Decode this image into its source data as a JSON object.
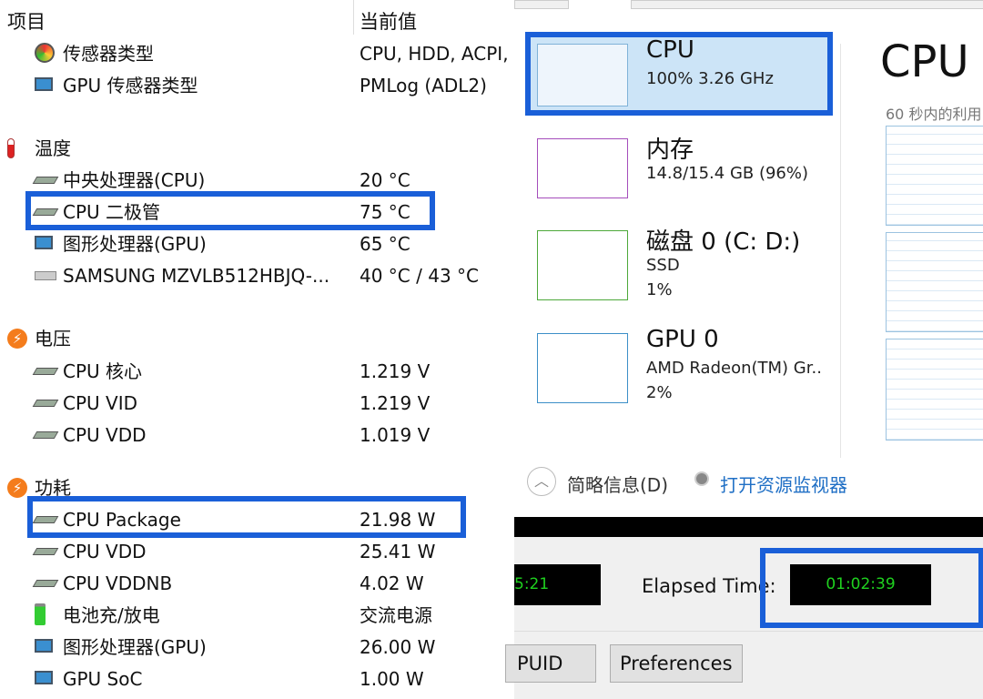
{
  "sensor_panel": {
    "header": {
      "item": "项目",
      "value": "当前值"
    },
    "rows": [
      {
        "type": "item",
        "icon": "gauge-icon",
        "label": "传感器类型",
        "value": "CPU, HDD, ACPI,"
      },
      {
        "type": "item",
        "icon": "monitor-icon",
        "label": "GPU 传感器类型",
        "value": "PMLog  (ADL2)"
      },
      {
        "type": "section",
        "icon": "thermometer-icon",
        "label": "温度"
      },
      {
        "type": "item",
        "icon": "chip-icon",
        "label": "中央处理器(CPU)",
        "value": "20 °C"
      },
      {
        "type": "item",
        "icon": "chip-icon",
        "label": "CPU 二极管",
        "value": "75 °C",
        "highlight": true
      },
      {
        "type": "item",
        "icon": "monitor-icon",
        "label": "图形处理器(GPU)",
        "value": "65 °C"
      },
      {
        "type": "item",
        "icon": "drive-icon",
        "label": "SAMSUNG MZVLB512HBJQ-...",
        "value": "40 °C / 43 °C"
      },
      {
        "type": "section",
        "icon": "lightning-icon",
        "label": "电压"
      },
      {
        "type": "item",
        "icon": "chip-icon",
        "label": "CPU 核心",
        "value": "1.219 V"
      },
      {
        "type": "item",
        "icon": "chip-icon",
        "label": "CPU VID",
        "value": "1.219 V"
      },
      {
        "type": "item",
        "icon": "chip-icon",
        "label": "CPU VDD",
        "value": "1.019 V"
      },
      {
        "type": "section",
        "icon": "lightning-icon",
        "label": "功耗"
      },
      {
        "type": "item",
        "icon": "chip-icon",
        "label": "CPU Package",
        "value": "21.98 W",
        "highlight": true
      },
      {
        "type": "item",
        "icon": "chip-icon",
        "label": "CPU VDD",
        "value": "25.41 W"
      },
      {
        "type": "item",
        "icon": "chip-icon",
        "label": "CPU VDDNB",
        "value": "4.02 W"
      },
      {
        "type": "item",
        "icon": "battery-icon",
        "label": "电池充/放电",
        "value": "交流电源"
      },
      {
        "type": "item",
        "icon": "monitor-icon",
        "label": "图形处理器(GPU)",
        "value": "26.00 W"
      },
      {
        "type": "item",
        "icon": "monitor-icon",
        "label": "GPU SoC",
        "value": "1.00 W"
      }
    ]
  },
  "task_manager": {
    "cards": [
      {
        "title": "CPU",
        "line1": "100%  3.26 GHz",
        "line2": "",
        "color": "#7fb2d8",
        "selected": true
      },
      {
        "title": "内存",
        "line1": "14.8/15.4 GB (96%)",
        "line2": "",
        "color": "#a54dbb"
      },
      {
        "title": "磁盘 0 (C: D:)",
        "line1": "SSD",
        "line2": "1%",
        "color": "#4da83a"
      },
      {
        "title": "GPU 0",
        "line1": "AMD Radeon(TM) Gr..",
        "line2": "2%",
        "color": "#3c8fc7"
      }
    ],
    "detail_title": "CPU",
    "detail_subtitle": "60 秒内的利用",
    "fewer_details": "简略信息(D)",
    "open_resource_monitor": "打开资源监视器"
  },
  "stress_tool": {
    "start_time_partial": "5:21",
    "elapsed_label": "Elapsed Time:",
    "elapsed_value": "01:02:39",
    "buttons": [
      "PUID",
      "Preferences"
    ]
  },
  "colors": {
    "highlight": "#1a5fd8",
    "lcd_text": "#1fd11f",
    "link": "#1f6fc5"
  }
}
